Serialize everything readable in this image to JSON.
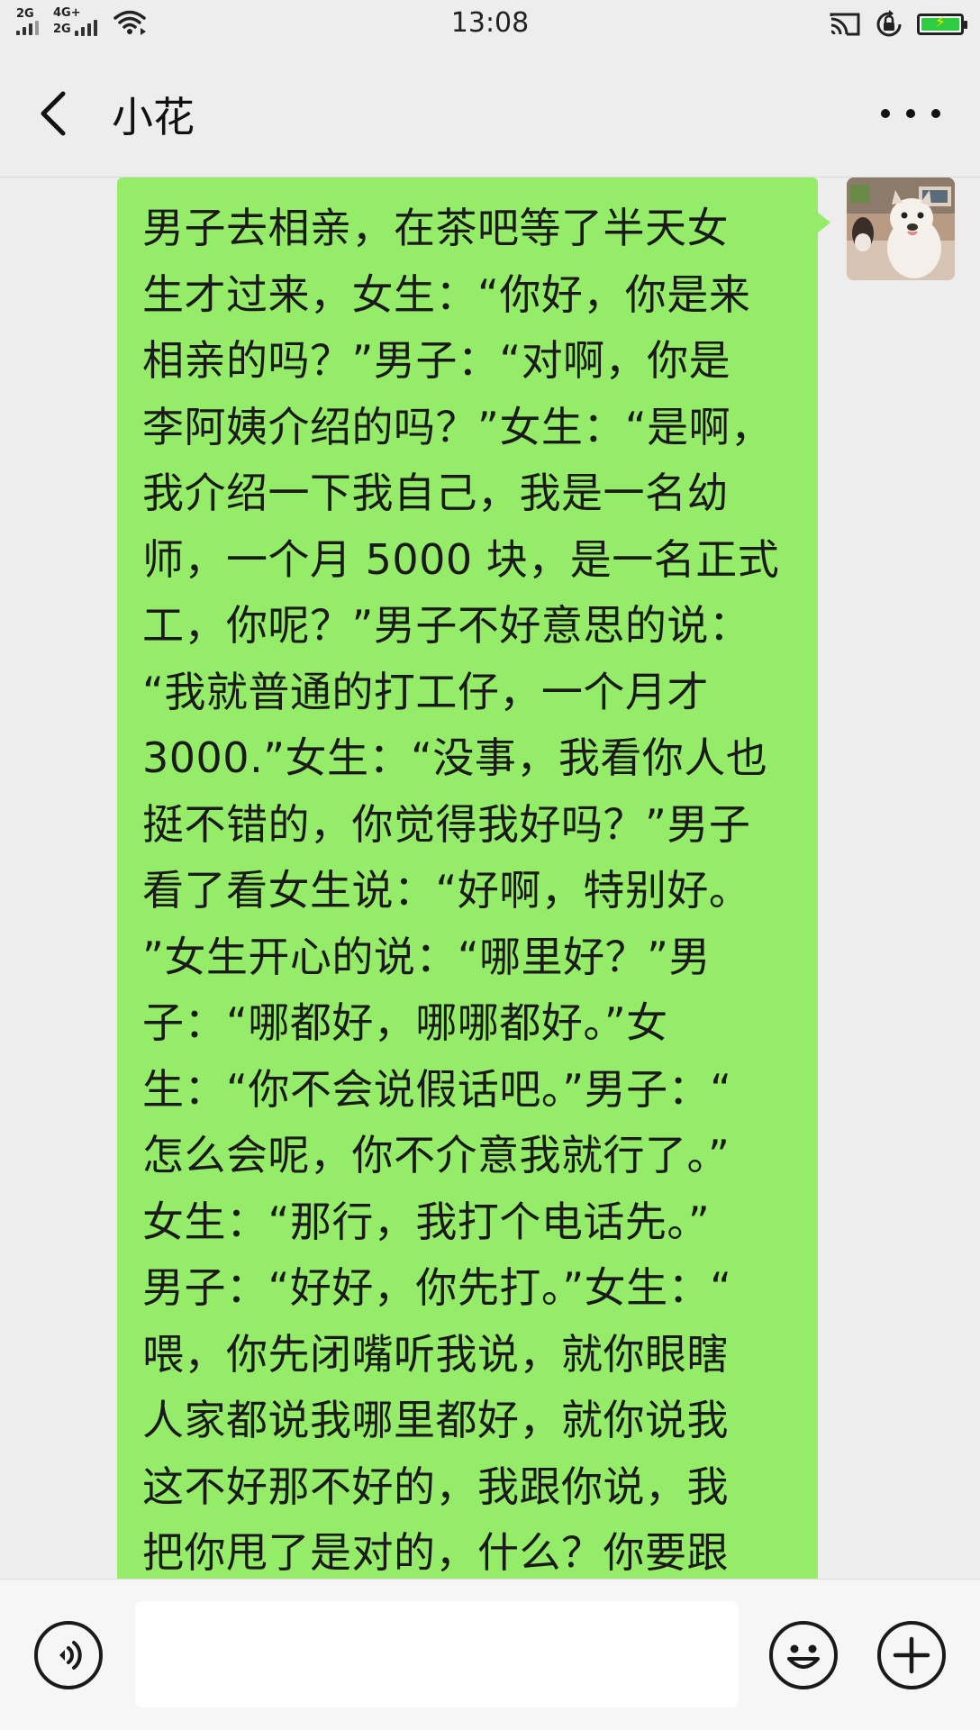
{
  "status_bar": {
    "sim1_label": "2G",
    "sim2_label_top": "4G+",
    "sim2_label_bottom": "2G",
    "time": "13:08",
    "battery_level": 1.0,
    "battery_color": "#2ecc40",
    "icons": [
      "signal-icon",
      "wifi-icon",
      "cast-icon",
      "rotation-lock-icon",
      "battery-icon"
    ]
  },
  "header": {
    "title": "小花",
    "back_icon": "chevron-left-icon",
    "more_icon": "more-icon"
  },
  "messages": [
    {
      "sender": "self",
      "bubble_color": "#95ec69",
      "lines": [
        "男子去相亲，在茶吧等了半天女",
        "生才过来，女生：“你好，你是来",
        "相亲的吗？”男子：“对啊，你是",
        "李阿姨介绍的吗？”女生：“是啊，",
        "我介绍一下我自己，我是一名幼",
        "师，一个月 5000 块，是一名正式",
        "工，你呢？”男子不好意思的说：",
        "“我就普通的打工仔，一个月才",
        "3000.”女生：“没事，我看你人也",
        "挺不错的，你觉得我好吗？”男子",
        "看了看女生说：“好啊，特别好。",
        "”女生开心的说：“哪里好？”男",
        "子：“哪都好，哪哪都好。”女",
        "生：“你不会说假话吧。”男子：“",
        "怎么会呢，你不介意我就行了。”",
        "女生：“那行，我打个电话先。”",
        "男子：“好好，你先打。”女生：“",
        "喂，你先闭嘴听我说，就你眼瞎",
        "人家都说我哪里都好，就你说我",
        "这不好那不好的，我跟你说，我",
        "把你甩了是对的，什么？你要跟"
      ]
    }
  ],
  "input_bar": {
    "voice_icon": "voice-icon",
    "input_value": "",
    "emoji_icon": "emoji-icon",
    "plus_icon": "plus-icon"
  }
}
